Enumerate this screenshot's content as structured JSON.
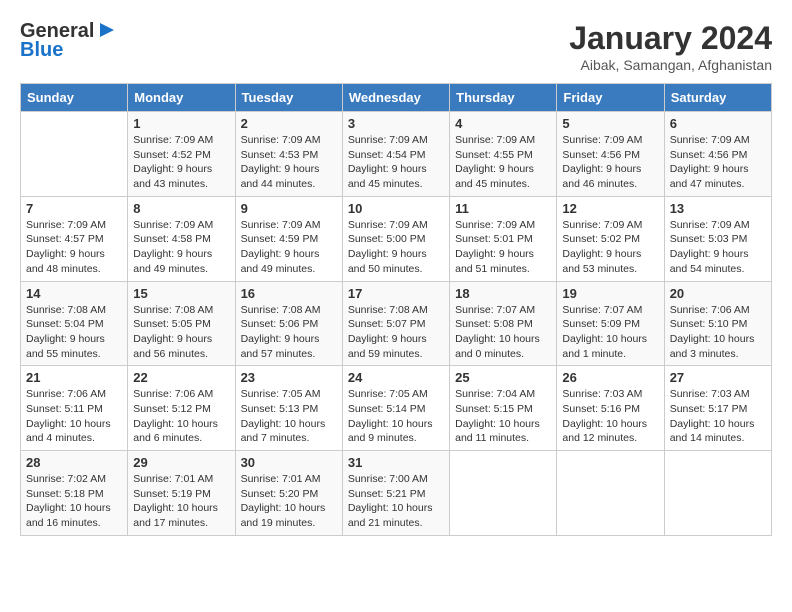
{
  "header": {
    "logo_line1": "General",
    "logo_line2": "Blue",
    "title": "January 2024",
    "location": "Aibak, Samangan, Afghanistan"
  },
  "columns": [
    "Sunday",
    "Monday",
    "Tuesday",
    "Wednesday",
    "Thursday",
    "Friday",
    "Saturday"
  ],
  "weeks": [
    [
      {
        "day": "",
        "info": ""
      },
      {
        "day": "1",
        "info": "Sunrise: 7:09 AM\nSunset: 4:52 PM\nDaylight: 9 hours\nand 43 minutes."
      },
      {
        "day": "2",
        "info": "Sunrise: 7:09 AM\nSunset: 4:53 PM\nDaylight: 9 hours\nand 44 minutes."
      },
      {
        "day": "3",
        "info": "Sunrise: 7:09 AM\nSunset: 4:54 PM\nDaylight: 9 hours\nand 45 minutes."
      },
      {
        "day": "4",
        "info": "Sunrise: 7:09 AM\nSunset: 4:55 PM\nDaylight: 9 hours\nand 45 minutes."
      },
      {
        "day": "5",
        "info": "Sunrise: 7:09 AM\nSunset: 4:56 PM\nDaylight: 9 hours\nand 46 minutes."
      },
      {
        "day": "6",
        "info": "Sunrise: 7:09 AM\nSunset: 4:56 PM\nDaylight: 9 hours\nand 47 minutes."
      }
    ],
    [
      {
        "day": "7",
        "info": "Sunrise: 7:09 AM\nSunset: 4:57 PM\nDaylight: 9 hours\nand 48 minutes."
      },
      {
        "day": "8",
        "info": "Sunrise: 7:09 AM\nSunset: 4:58 PM\nDaylight: 9 hours\nand 49 minutes."
      },
      {
        "day": "9",
        "info": "Sunrise: 7:09 AM\nSunset: 4:59 PM\nDaylight: 9 hours\nand 49 minutes."
      },
      {
        "day": "10",
        "info": "Sunrise: 7:09 AM\nSunset: 5:00 PM\nDaylight: 9 hours\nand 50 minutes."
      },
      {
        "day": "11",
        "info": "Sunrise: 7:09 AM\nSunset: 5:01 PM\nDaylight: 9 hours\nand 51 minutes."
      },
      {
        "day": "12",
        "info": "Sunrise: 7:09 AM\nSunset: 5:02 PM\nDaylight: 9 hours\nand 53 minutes."
      },
      {
        "day": "13",
        "info": "Sunrise: 7:09 AM\nSunset: 5:03 PM\nDaylight: 9 hours\nand 54 minutes."
      }
    ],
    [
      {
        "day": "14",
        "info": "Sunrise: 7:08 AM\nSunset: 5:04 PM\nDaylight: 9 hours\nand 55 minutes."
      },
      {
        "day": "15",
        "info": "Sunrise: 7:08 AM\nSunset: 5:05 PM\nDaylight: 9 hours\nand 56 minutes."
      },
      {
        "day": "16",
        "info": "Sunrise: 7:08 AM\nSunset: 5:06 PM\nDaylight: 9 hours\nand 57 minutes."
      },
      {
        "day": "17",
        "info": "Sunrise: 7:08 AM\nSunset: 5:07 PM\nDaylight: 9 hours\nand 59 minutes."
      },
      {
        "day": "18",
        "info": "Sunrise: 7:07 AM\nSunset: 5:08 PM\nDaylight: 10 hours\nand 0 minutes."
      },
      {
        "day": "19",
        "info": "Sunrise: 7:07 AM\nSunset: 5:09 PM\nDaylight: 10 hours\nand 1 minute."
      },
      {
        "day": "20",
        "info": "Sunrise: 7:06 AM\nSunset: 5:10 PM\nDaylight: 10 hours\nand 3 minutes."
      }
    ],
    [
      {
        "day": "21",
        "info": "Sunrise: 7:06 AM\nSunset: 5:11 PM\nDaylight: 10 hours\nand 4 minutes."
      },
      {
        "day": "22",
        "info": "Sunrise: 7:06 AM\nSunset: 5:12 PM\nDaylight: 10 hours\nand 6 minutes."
      },
      {
        "day": "23",
        "info": "Sunrise: 7:05 AM\nSunset: 5:13 PM\nDaylight: 10 hours\nand 7 minutes."
      },
      {
        "day": "24",
        "info": "Sunrise: 7:05 AM\nSunset: 5:14 PM\nDaylight: 10 hours\nand 9 minutes."
      },
      {
        "day": "25",
        "info": "Sunrise: 7:04 AM\nSunset: 5:15 PM\nDaylight: 10 hours\nand 11 minutes."
      },
      {
        "day": "26",
        "info": "Sunrise: 7:03 AM\nSunset: 5:16 PM\nDaylight: 10 hours\nand 12 minutes."
      },
      {
        "day": "27",
        "info": "Sunrise: 7:03 AM\nSunset: 5:17 PM\nDaylight: 10 hours\nand 14 minutes."
      }
    ],
    [
      {
        "day": "28",
        "info": "Sunrise: 7:02 AM\nSunset: 5:18 PM\nDaylight: 10 hours\nand 16 minutes."
      },
      {
        "day": "29",
        "info": "Sunrise: 7:01 AM\nSunset: 5:19 PM\nDaylight: 10 hours\nand 17 minutes."
      },
      {
        "day": "30",
        "info": "Sunrise: 7:01 AM\nSunset: 5:20 PM\nDaylight: 10 hours\nand 19 minutes."
      },
      {
        "day": "31",
        "info": "Sunrise: 7:00 AM\nSunset: 5:21 PM\nDaylight: 10 hours\nand 21 minutes."
      },
      {
        "day": "",
        "info": ""
      },
      {
        "day": "",
        "info": ""
      },
      {
        "day": "",
        "info": ""
      }
    ]
  ]
}
